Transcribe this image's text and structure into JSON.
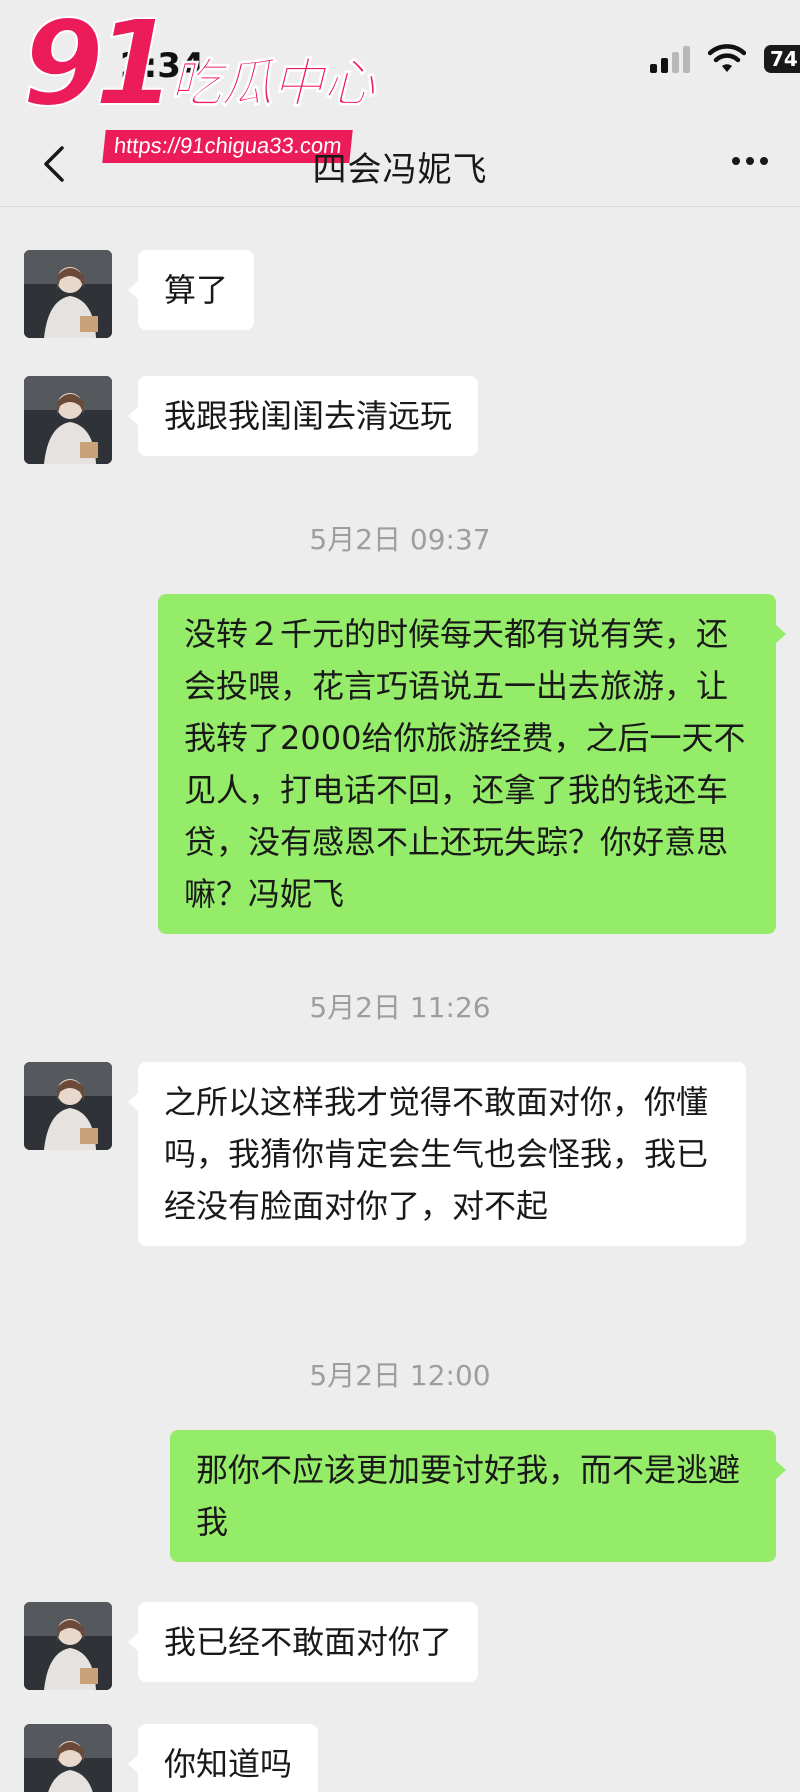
{
  "status_bar": {
    "time": "2:34",
    "battery": "74"
  },
  "watermark": {
    "number": "91",
    "title": "吃瓜中心",
    "url": "https://91chigua33.com"
  },
  "chat": {
    "title": "四会冯妮飞",
    "messages": [
      {
        "type": "in",
        "text": "算了"
      },
      {
        "type": "in",
        "text": "我跟我闺闺去清远玩"
      },
      {
        "type": "time",
        "text": "5月2日 09:37"
      },
      {
        "type": "out",
        "text": "没转２千元的时候每天都有说有笑，还会投喂，花言巧语说五一出去旅游，让我转了2000给你旅游经费，之后一天不见人，打电话不回，还拿了我的钱还车贷，没有感恩不止还玩失踪？你好意思嘛？冯妮飞"
      },
      {
        "type": "time",
        "text": "5月2日 11:26"
      },
      {
        "type": "in",
        "text": "之所以这样我才觉得不敢面对你，你懂吗，我猜你肯定会生气也会怪我，我已经没有脸面对你了，对不起"
      },
      {
        "type": "time",
        "text": "5月2日 12:00"
      },
      {
        "type": "out",
        "text": "那你不应该更加要讨好我，而不是逃避我"
      },
      {
        "type": "in",
        "text": "我已经不敢面对你了"
      },
      {
        "type": "in",
        "text": "你知道吗"
      }
    ]
  },
  "colors": {
    "incoming_bubble": "#ffffff",
    "outgoing_bubble": "#95ec69",
    "background": "#ededed",
    "watermark": "#ec1b5a"
  }
}
